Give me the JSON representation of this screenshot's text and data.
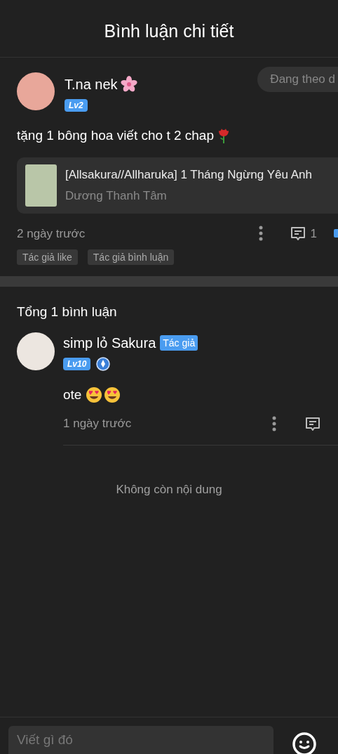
{
  "header": {
    "title": "Bình luận chi tiết"
  },
  "post": {
    "author": "T.na nek",
    "level": "Lv2",
    "follow_button": "Đang theo d",
    "text": "tặng 1 bông hoa viết cho t 2 chap",
    "book": {
      "title": "[Allsakura//Allharuka] 1 Tháng Ngừng Yêu Anh",
      "author": "Dương Thanh Tâm"
    },
    "time": "2 ngày trước",
    "reply_count": "1",
    "tags": [
      "Tác giả like",
      "Tác giả bình luận"
    ]
  },
  "comments_header": "Tổng 1 bình luận",
  "comments": [
    {
      "author": "simp lỏ Sakura",
      "role_badge": "Tác giả",
      "level": "Lv10",
      "text": "ote",
      "time": "1 ngày trước"
    }
  ],
  "end_text": "Không còn nội dung",
  "composer": {
    "placeholder": "Viết gì đó"
  }
}
